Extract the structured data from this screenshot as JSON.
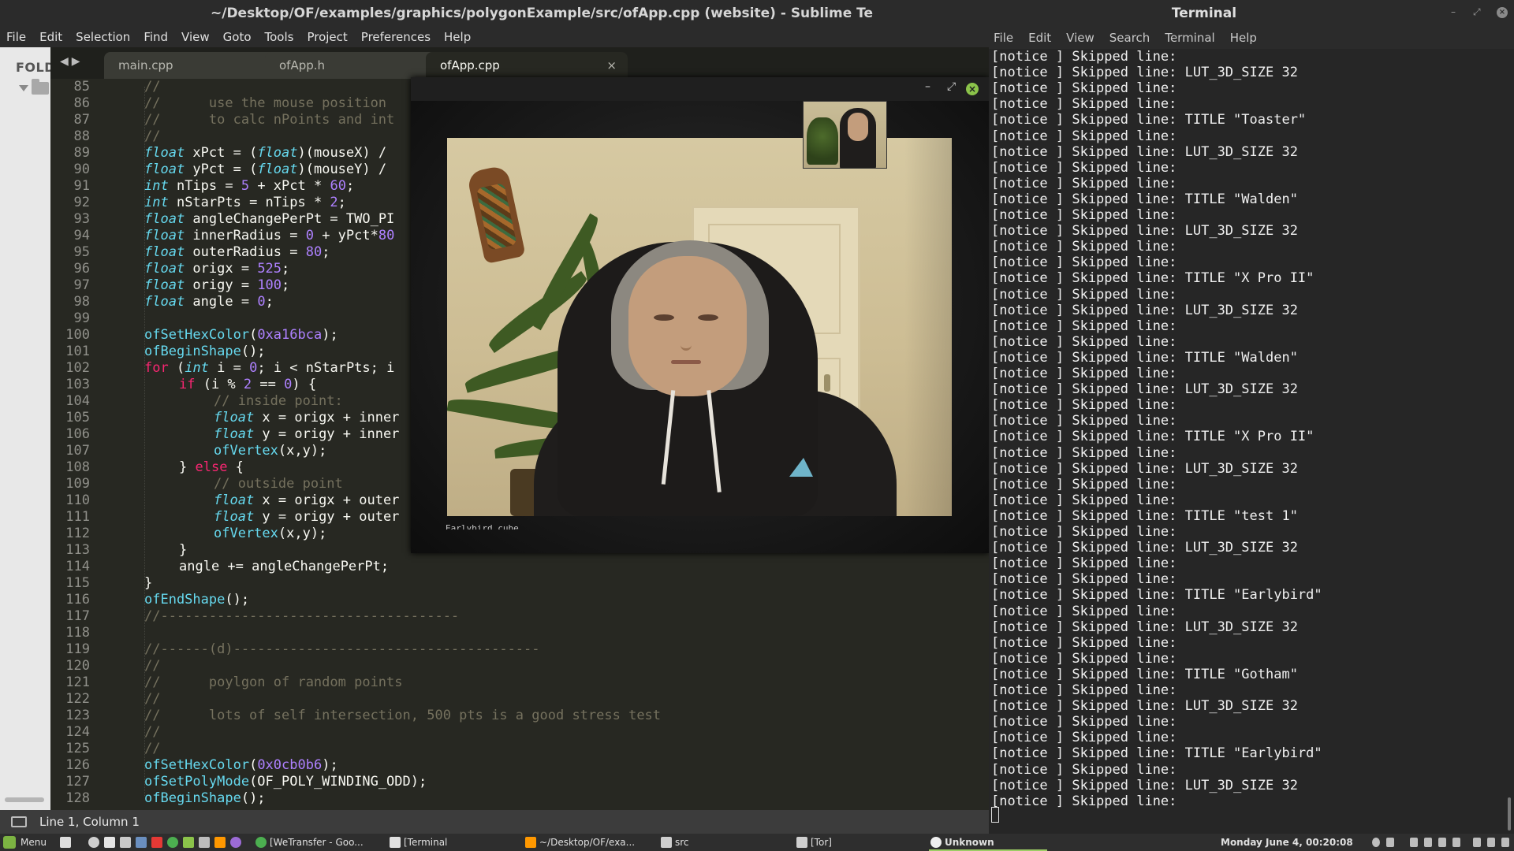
{
  "sublime": {
    "title": "~/Desktop/OF/examples/graphics/polygonExample/src/ofApp.cpp (website) - Sublime Te",
    "menu": [
      "File",
      "Edit",
      "Selection",
      "Find",
      "View",
      "Goto",
      "Tools",
      "Project",
      "Preferences",
      "Help"
    ],
    "sidebar_label": "FOLD",
    "tabs": [
      {
        "label": "main.cpp",
        "active": false
      },
      {
        "label": "ofApp.h",
        "active": false
      },
      {
        "label": "ofApp.cpp",
        "active": true
      }
    ],
    "tab_close": "×",
    "status": "Line 1, Column 1",
    "line_numbers": [
      "85",
      "86",
      "87",
      "88",
      "89",
      "90",
      "91",
      "92",
      "93",
      "94",
      "95",
      "96",
      "97",
      "98",
      "99",
      "100",
      "101",
      "102",
      "103",
      "104",
      "105",
      "106",
      "107",
      "108",
      "109",
      "110",
      "111",
      "112",
      "113",
      "114",
      "115",
      "116",
      "117",
      "118",
      "119",
      "120",
      "121",
      "122",
      "123",
      "124",
      "125",
      "126",
      "127",
      "128"
    ],
    "code": {
      "l85": "//",
      "l86": "//      use the mouse position",
      "l87": "//      to calc nPoints and int",
      "l88": "//",
      "l89_kw": "float",
      "l89_a": " xPct = (",
      "l89_kw2": "float",
      "l89_b": ")(mouseX) /",
      "l90_kw": "float",
      "l90_a": " yPct = (",
      "l90_kw2": "float",
      "l90_b": ")(mouseY) /",
      "l91_kw": "int",
      "l91_a": " nTips = ",
      "l91_n1": "5",
      "l91_b": " + xPct * ",
      "l91_n2": "60",
      "l91_c": ";",
      "l92_kw": "int",
      "l92_a": " nStarPts = nTips * ",
      "l92_n1": "2",
      "l92_b": ";",
      "l93_kw": "float",
      "l93_a": " angleChangePerPt = TWO_PI",
      "l94_kw": "float",
      "l94_a": " innerRadius = ",
      "l94_n1": "0",
      "l94_b": " + yPct*",
      "l94_n2": "80",
      "l95_kw": "float",
      "l95_a": " outerRadius = ",
      "l95_n1": "80",
      "l95_b": ";",
      "l96_kw": "float",
      "l96_a": " origx = ",
      "l96_n1": "525",
      "l96_b": ";",
      "l97_kw": "float",
      "l97_a": " origy = ",
      "l97_n1": "100",
      "l97_b": ";",
      "l98_kw": "float",
      "l98_a": " angle = ",
      "l98_n1": "0",
      "l98_b": ";",
      "l100_fn": "ofSetHexColor",
      "l100_a": "(",
      "l100_n1": "0xa16bca",
      "l100_b": ");",
      "l101_fn": "ofBeginShape",
      "l101_a": "();",
      "l102_kw": "for",
      "l102_a": " (",
      "l102_kw2": "int",
      "l102_b": " i = ",
      "l102_n1": "0",
      "l102_c": "; i < nStarPts; i",
      "l103_kw": "if",
      "l103_a": " (i % ",
      "l103_n1": "2",
      "l103_b": " == ",
      "l103_n2": "0",
      "l103_c": ") {",
      "l104": "// inside point:",
      "l105_kw": "float",
      "l105_a": " x = origx + inner",
      "l106_kw": "float",
      "l106_a": " y = origy + inner",
      "l107_fn": "ofVertex",
      "l107_a": "(x,y);",
      "l108_a": "} ",
      "l108_kw": "else",
      "l108_b": " {",
      "l109": "// outside point",
      "l110_kw": "float",
      "l110_a": " x = origx + outer",
      "l111_kw": "float",
      "l111_a": " y = origy + outer",
      "l112_fn": "ofVertex",
      "l112_a": "(x,y);",
      "l113": "}",
      "l114": "angle += angleChangePerPt;",
      "l115": "}",
      "l116_fn": "ofEndShape",
      "l116_a": "();",
      "l117": "//-------------------------------------",
      "l119": "//------(d)--------------------------------------",
      "l120": "//",
      "l121": "//      poylgon of random points",
      "l122": "//",
      "l123": "//      lots of self intersection, 500 pts is a good stress test",
      "l124": "//",
      "l125": "//",
      "l126_fn": "ofSetHexColor",
      "l126_a": "(",
      "l126_n1": "0x0cb0b6",
      "l126_b": ");",
      "l127_fn": "ofSetPolyMode",
      "l127_a": "(OF_POLY_WINDING_ODD);",
      "l128_fn": "ofBeginShape",
      "l128_a": "();"
    }
  },
  "camera_window": {
    "caption": "Earlybird cube",
    "controls": {
      "minimize": "–",
      "maximize": "⤢",
      "close": "×"
    }
  },
  "terminal": {
    "title": "Terminal",
    "menu": [
      "File",
      "Edit",
      "View",
      "Search",
      "Terminal",
      "Help"
    ],
    "lines": [
      "[notice ] Skipped line:",
      "[notice ] Skipped line: LUT_3D_SIZE 32",
      "[notice ] Skipped line:",
      "[notice ] Skipped line:",
      "[notice ] Skipped line: TITLE \"Toaster\"",
      "[notice ] Skipped line:",
      "[notice ] Skipped line: LUT_3D_SIZE 32",
      "[notice ] Skipped line:",
      "[notice ] Skipped line:",
      "[notice ] Skipped line: TITLE \"Walden\"",
      "[notice ] Skipped line:",
      "[notice ] Skipped line: LUT_3D_SIZE 32",
      "[notice ] Skipped line:",
      "[notice ] Skipped line:",
      "[notice ] Skipped line: TITLE \"X Pro II\"",
      "[notice ] Skipped line:",
      "[notice ] Skipped line: LUT_3D_SIZE 32",
      "[notice ] Skipped line:",
      "[notice ] Skipped line:",
      "[notice ] Skipped line: TITLE \"Walden\"",
      "[notice ] Skipped line:",
      "[notice ] Skipped line: LUT_3D_SIZE 32",
      "[notice ] Skipped line:",
      "[notice ] Skipped line:",
      "[notice ] Skipped line: TITLE \"X Pro II\"",
      "[notice ] Skipped line:",
      "[notice ] Skipped line: LUT_3D_SIZE 32",
      "[notice ] Skipped line:",
      "[notice ] Skipped line:",
      "[notice ] Skipped line: TITLE \"test 1\"",
      "[notice ] Skipped line:",
      "[notice ] Skipped line: LUT_3D_SIZE 32",
      "[notice ] Skipped line:",
      "[notice ] Skipped line:",
      "[notice ] Skipped line: TITLE \"Earlybird\"",
      "[notice ] Skipped line:",
      "[notice ] Skipped line: LUT_3D_SIZE 32",
      "[notice ] Skipped line:",
      "[notice ] Skipped line:",
      "[notice ] Skipped line: TITLE \"Gotham\"",
      "[notice ] Skipped line:",
      "[notice ] Skipped line: LUT_3D_SIZE 32",
      "[notice ] Skipped line:",
      "[notice ] Skipped line:",
      "[notice ] Skipped line: TITLE \"Earlybird\"",
      "[notice ] Skipped line:",
      "[notice ] Skipped line: LUT_3D_SIZE 32",
      "[notice ] Skipped line:"
    ]
  },
  "taskbar": {
    "menu_label": "Menu",
    "tasks": [
      {
        "label": "[WeTransfer - Goo...",
        "icon": "chrome-icon"
      },
      {
        "label": "[Terminal",
        "icon": "terminal-icon"
      },
      {
        "label": "~/Desktop/OF/exa...",
        "icon": "sublime-icon"
      },
      {
        "label": "src",
        "icon": "folder-icon"
      },
      {
        "label": "[Tor]",
        "icon": "folder-icon"
      },
      {
        "label": "Unknown",
        "icon": "app-icon",
        "active": true
      }
    ],
    "clock": "Monday June  4, 00:20:08"
  },
  "colors": {
    "editor_bg": "#272822",
    "keyword": "#66d9ef",
    "control": "#f92672",
    "number": "#ae81ff",
    "comment": "#75715e",
    "terminal_bg": "#262626",
    "mint_green": "#7cb342"
  }
}
